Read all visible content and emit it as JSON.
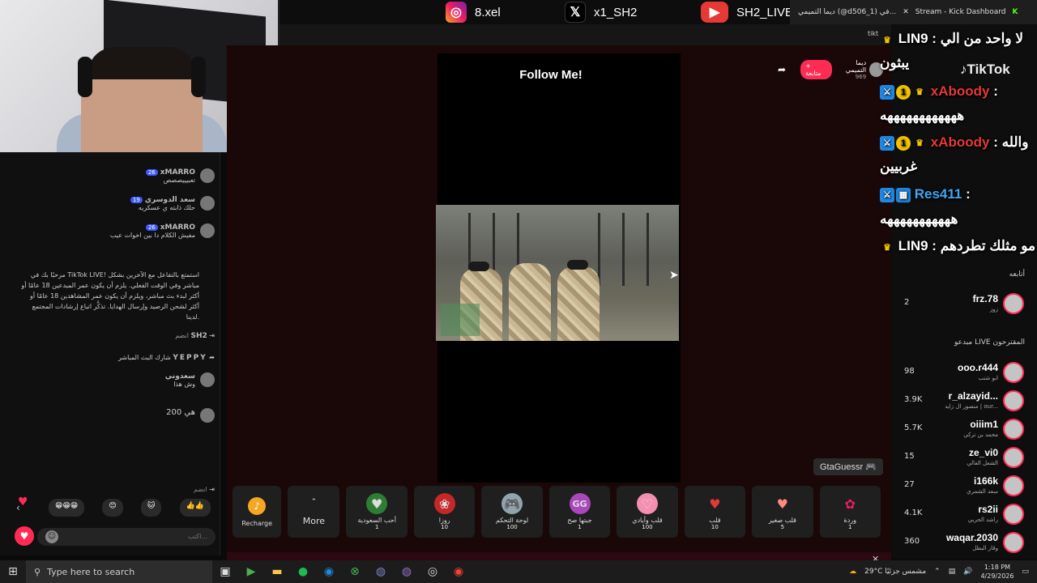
{
  "top_banner": {
    "instagram": {
      "icon": "instagram-icon",
      "handle": "8.xel"
    },
    "x": {
      "icon": "x-icon",
      "handle": "x1_SH2"
    },
    "youtube": {
      "icon": "youtube-icon",
      "handle": "SH2_LIVE"
    }
  },
  "browser": {
    "tab1": "ديما التميمي (@d506_1) في...",
    "tab2": "Stream - Kick Dashboard",
    "url": "tikt"
  },
  "stream": {
    "overlay_title": "Follow Me!",
    "streamer_name": "ديما التميمي",
    "streamer_likes": "969",
    "follow_button": "+ متابعة",
    "game_tag": "GtaGuessr",
    "game_icon": "gamepad-icon"
  },
  "gifts": {
    "recharge_label": "Recharge",
    "more_label": "More",
    "items": [
      {
        "name": "أحب السعودية",
        "price": "1"
      },
      {
        "name": "روزا",
        "price": "10"
      },
      {
        "name": "لوحة التحكم",
        "price": "100"
      },
      {
        "name": "جبتها صح",
        "price": "1"
      },
      {
        "name": "قلب وأيادي",
        "price": "100"
      },
      {
        "name": "قلب",
        "price": "10"
      },
      {
        "name": "قلب صغير",
        "price": "5"
      },
      {
        "name": "وردة",
        "price": "1"
      }
    ]
  },
  "chat": {
    "messages": [
      {
        "user": "xMARRO",
        "level": "26",
        "text": "تعبيييصصص"
      },
      {
        "user": "سعد الدوسري",
        "level": "19",
        "text": "حلك ذابته ي عسكريه"
      },
      {
        "user": "xMARRO",
        "level": "26",
        "text": "مفيش الكلام دا بين اخوات عيب"
      }
    ],
    "welcome": "مرحبًا بك في TikTok LIVE! استمتع بالتفاعل مع الآخرين بشكل مباشر وفي الوقت الفعلي. يلزم أن يكون عمر المبدعين 18 عامًا أو أكثر لبدء بث مباشر، ويلزم أن يكون عمر المشاهدين 18 عامًا أو أكثر لشحن الرصيد وإرسال الهدايا. تذكَّر اتباع إرشادات المجتمع لدينا.",
    "join_user": "SH2",
    "join_text": "انضم",
    "share_user": "YEPPY",
    "share_text": "شارك البث المباشر",
    "msg4_user": "سعدوني",
    "msg4_text": "وش هذا",
    "msg5_text": "هي 200",
    "small_join": "انضم",
    "input_placeholder": "اكتب...",
    "reactions": [
      "😁😁😁",
      "😊",
      "🐱",
      "👍👍"
    ]
  },
  "overlay_chat": [
    {
      "user": "LIN9",
      "text": "لا واحد من الي"
    },
    {
      "user": "",
      "text": "يبثون"
    },
    {
      "user": "xAboody",
      "text": ""
    },
    {
      "user": "",
      "text": "ههههههههههههه"
    },
    {
      "user": "xAboody",
      "text": "والله"
    },
    {
      "user": "",
      "text": "غربيين"
    },
    {
      "user": "Res411",
      "text": ""
    },
    {
      "user": "",
      "text": "هههههههههههه"
    },
    {
      "user": "LIN9",
      "text": "مو مثلك تطردهم"
    }
  ],
  "right_panel": {
    "tiktok_label": "TikTok",
    "following_title": "أتابعه",
    "following": [
      {
        "name": "frz.78",
        "sub": "زوز",
        "count": "2"
      }
    ],
    "suggested_title": "مبدعو LIVE المقترحون",
    "suggested": [
      {
        "name": "ooo.r444",
        "sub": "ابو شنب",
        "count": "98"
      },
      {
        "name": "r_alzayid...",
        "sub": "منصور ال زايد | our...",
        "count": "3.9K"
      },
      {
        "name": "oiiim1",
        "sub": "محمد بن تركي",
        "count": "5.7K"
      },
      {
        "name": "ze_vi0",
        "sub": "الشعل العالي",
        "count": "15"
      },
      {
        "name": "i166k",
        "sub": "سعد الشمري",
        "count": "27"
      },
      {
        "name": "rs2ii",
        "sub": "راشد الحربي",
        "count": "4.1K"
      },
      {
        "name": "waqar.2030",
        "sub": "وقار البطل",
        "count": "360"
      }
    ]
  },
  "taskbar": {
    "search_placeholder": "Type here to search",
    "weather": "29°C مشمس جزئيًا",
    "time": "1:18 PM",
    "date": "4/29/2026"
  }
}
